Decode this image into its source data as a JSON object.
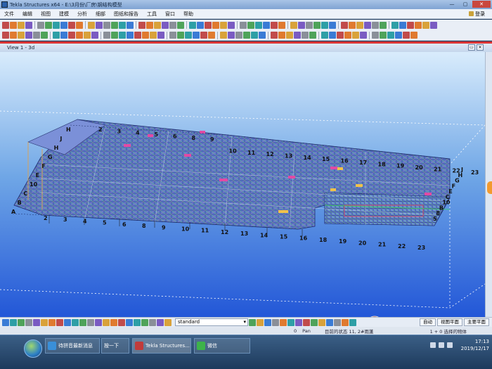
{
  "window": {
    "title": "Tekla Structures x64 - E:\\3月份\\厂房\\钢结构模型"
  },
  "menu": [
    "文件",
    "编辑",
    "视图",
    "建模",
    "分析",
    "细部",
    "图纸和报告",
    "工具",
    "窗口",
    "帮助"
  ],
  "menu_login": "登录",
  "view": {
    "title": "View 1 - 3d"
  },
  "grid_labels": {
    "top": [
      "2",
      "3",
      "4",
      "5",
      "6",
      "8",
      "9",
      "10",
      "11",
      "12",
      "13",
      "14",
      "15",
      "16",
      "17",
      "18",
      "19",
      "20",
      "21",
      "22",
      "23"
    ],
    "bottom": [
      "2",
      "3",
      "4",
      "5",
      "6",
      "8",
      "9",
      "10",
      "11",
      "12",
      "13",
      "14",
      "15",
      "16",
      "18",
      "19",
      "20",
      "21",
      "22",
      "23"
    ],
    "left": [
      "H",
      "J",
      "H",
      "G",
      "F",
      "E",
      "10",
      "C",
      "B",
      "A"
    ],
    "right": [
      "J",
      "H",
      "G",
      "F",
      "E",
      "C",
      "10",
      "B",
      "8",
      "5"
    ]
  },
  "bottom_toolbar": {
    "filter_combo": "standard",
    "combo_right_1": "自动",
    "combo_right_2": "视图平面",
    "combo_right_3": "主要平面"
  },
  "status": {
    "count": "0",
    "mode": "Pan",
    "message": "目前的状态 11, 2#雨蓬",
    "selected": "1 + 0 选择的物体"
  },
  "taskbar": {
    "items": [
      {
        "label": "待拼音最新消息",
        "icon_color": "#3a8fd8"
      },
      {
        "label": "按一下",
        "icon_color": "#2c73c5"
      },
      {
        "label": "Tekla Structures...",
        "icon_color": "#c13b3b"
      },
      {
        "label": "微信",
        "icon_color": "#3db34a"
      }
    ],
    "time": "17:13",
    "date": "2019/12/17"
  }
}
